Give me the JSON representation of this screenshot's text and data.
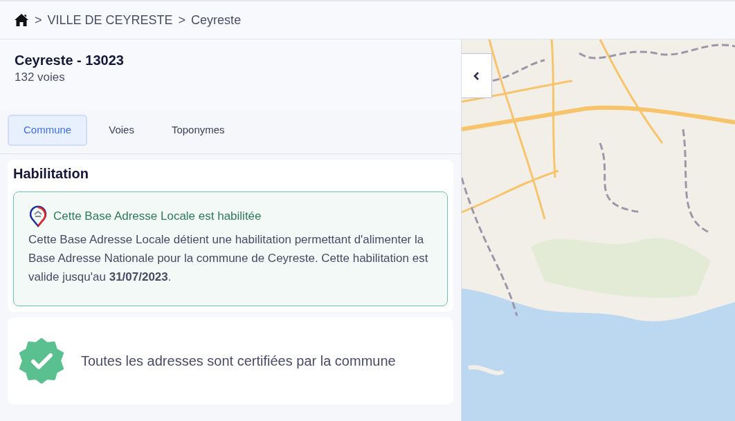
{
  "breadcrumb": [
    {
      "separator": ">",
      "label": "VILLE DE CEYRESTE"
    },
    {
      "separator": ">",
      "label": "Ceyreste"
    }
  ],
  "commune": {
    "title": "Ceyreste - 13023",
    "subtitle": "132 voies"
  },
  "tabs": [
    {
      "label": "Commune",
      "selected": true
    },
    {
      "label": "Voies",
      "selected": false
    },
    {
      "label": "Toponymes",
      "selected": false
    }
  ],
  "habilitation": {
    "heading": "Habilitation",
    "alert_title": "Cette Base Adresse Locale est habilitée",
    "alert_text": "Cette Base Adresse Locale détient une habilitation permettant d'alimenter la Base Adresse Nationale pour la commune de Ceyreste. Cette habilitation est valide jusqu'au **31/07/2023**."
  },
  "certification": {
    "text": "Toutes les adresses sont certifiées par la commune"
  }
}
